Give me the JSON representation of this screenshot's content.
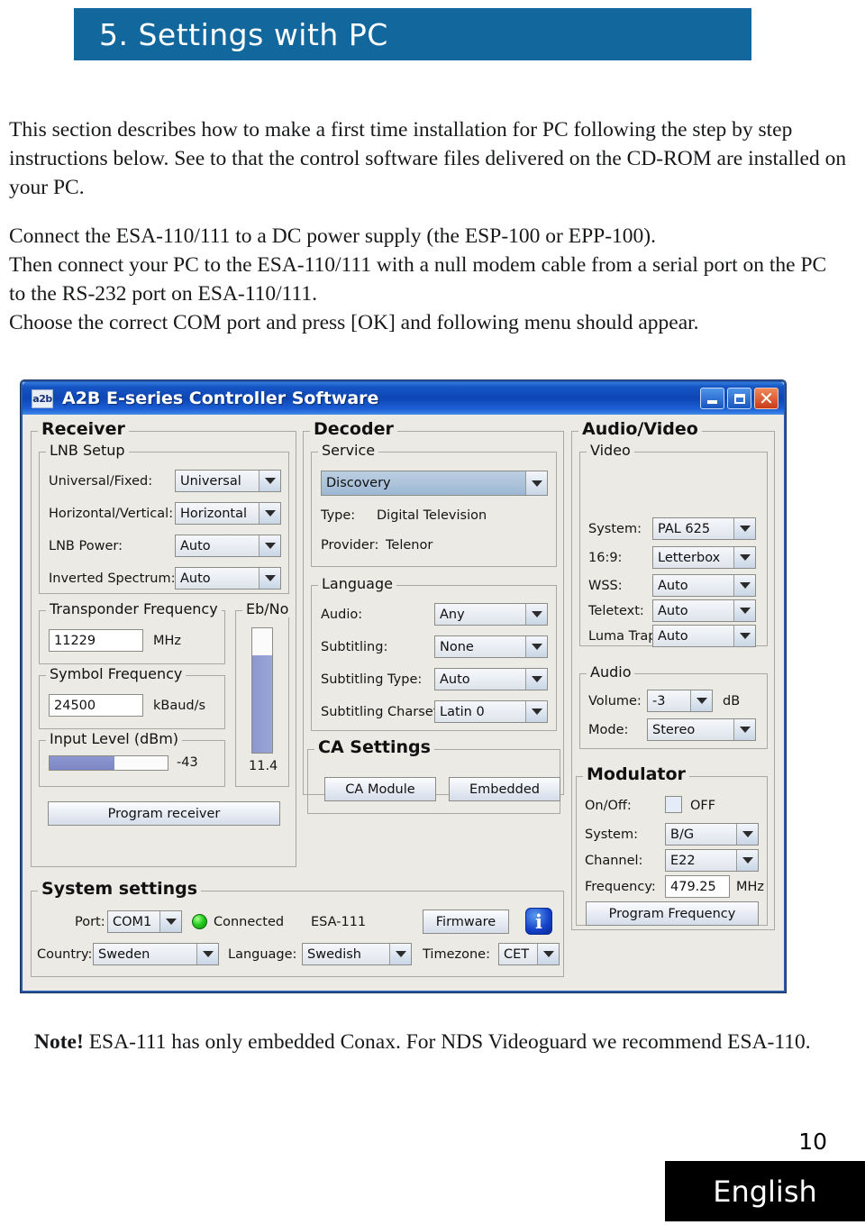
{
  "header": {
    "chapter_title": "5. Settings with PC",
    "banner_color": "#12679c"
  },
  "intro": {
    "paragraph1": "This section describes how to make a first time installation for PC following the step by step instructions below. See to that the control software files delivered on the CD-ROM are installed on your PC.",
    "paragraph2": "Connect the ESA-110/111 to a DC power supply (the ESP-100 or EPP-100).",
    "paragraph3": "Then connect your PC to the ESA-110/111 with a null modem cable from a serial port on the PC to the RS-232 port on ESA-110/111.",
    "paragraph4": "Choose the correct COM port and press [OK] and following menu should appear."
  },
  "app": {
    "icon_label": "a2b",
    "title": "A2B E-series Controller Software",
    "window_buttons": {
      "minimize": "Minimize",
      "maximize": "Maximize",
      "close": "Close"
    },
    "receiver": {
      "group_label": "Receiver",
      "lnb_setup": {
        "group_label": "LNB Setup",
        "fields": [
          {
            "label": "Universal/Fixed:",
            "value": "Universal"
          },
          {
            "label": "Horizontal/Vertical:",
            "value": "Horizontal"
          },
          {
            "label": "LNB Power:",
            "value": "Auto"
          },
          {
            "label": "Inverted Spectrum:",
            "value": "Auto"
          }
        ]
      },
      "transponder_frequency": {
        "group_label": "Transponder Frequency",
        "value": "11229",
        "unit": "MHz"
      },
      "symbol_frequency": {
        "group_label": "Symbol Frequency",
        "value": "24500",
        "unit": "kBaud/s"
      },
      "input_level": {
        "group_label": "Input Level (dBm)",
        "value": "-43",
        "fill_percent": 55
      },
      "ebno": {
        "group_label": "Eb/No",
        "value": "11.4",
        "fill_percent": 78
      },
      "program_receiver_button": "Program receiver"
    },
    "decoder": {
      "group_label": "Decoder",
      "service": {
        "group_label": "Service",
        "selected": "Discovery",
        "type_label": "Type:",
        "type_value": "Digital Television",
        "provider_label": "Provider:",
        "provider_value": "Telenor"
      },
      "language": {
        "group_label": "Language",
        "fields": [
          {
            "label": "Audio:",
            "value": "Any"
          },
          {
            "label": "Subtitling:",
            "value": "None"
          },
          {
            "label": "Subtitling Type:",
            "value": "Auto"
          },
          {
            "label": "Subtitling Charset:",
            "value": "Latin 0"
          }
        ]
      },
      "ca_settings": {
        "group_label": "CA Settings",
        "ca_module_button": "CA Module",
        "embedded_button": "Embedded"
      }
    },
    "audio_video": {
      "group_label": "Audio/Video",
      "video": {
        "group_label": "Video",
        "fields": [
          {
            "label": "System:",
            "value": "PAL 625"
          },
          {
            "label": "16:9:",
            "value": "Letterbox"
          },
          {
            "label": "WSS:",
            "value": "Auto"
          },
          {
            "label": "Teletext:",
            "value": "Auto"
          },
          {
            "label": "Luma Trap:",
            "value": "Auto"
          }
        ]
      },
      "audio": {
        "group_label": "Audio",
        "volume_label": "Volume:",
        "volume_value": "-3",
        "volume_unit": "dB",
        "mode_label": "Mode:",
        "mode_value": "Stereo"
      },
      "modulator": {
        "group_label": "Modulator",
        "onoff_label": "On/Off:",
        "onoff_value": "OFF",
        "onoff_checked": false,
        "system_label": "System:",
        "system_value": "B/G",
        "channel_label": "Channel:",
        "channel_value": "E22",
        "frequency_label": "Frequency:",
        "frequency_value": "479.25",
        "frequency_unit": "MHz",
        "program_frequency_button": "Program Frequency"
      }
    },
    "system_settings": {
      "group_label": "System settings",
      "port_label": "Port:",
      "port_value": "COM1",
      "status_led": "#28cc22",
      "status_text": "Connected",
      "device_model": "ESA-111",
      "firmware_button": "Firmware",
      "info_icon_glyph": "i",
      "country_label": "Country:",
      "country_value": "Sweden",
      "language_label": "Language:",
      "language_value": "Swedish",
      "timezone_label": "Timezone:",
      "timezone_value": "CET"
    }
  },
  "note": {
    "prefix": "Note!",
    "text": " ESA-111 has only embedded Conax. For NDS Videoguard we recommend ESA-110."
  },
  "footer": {
    "page_number": "10",
    "language": "English"
  }
}
